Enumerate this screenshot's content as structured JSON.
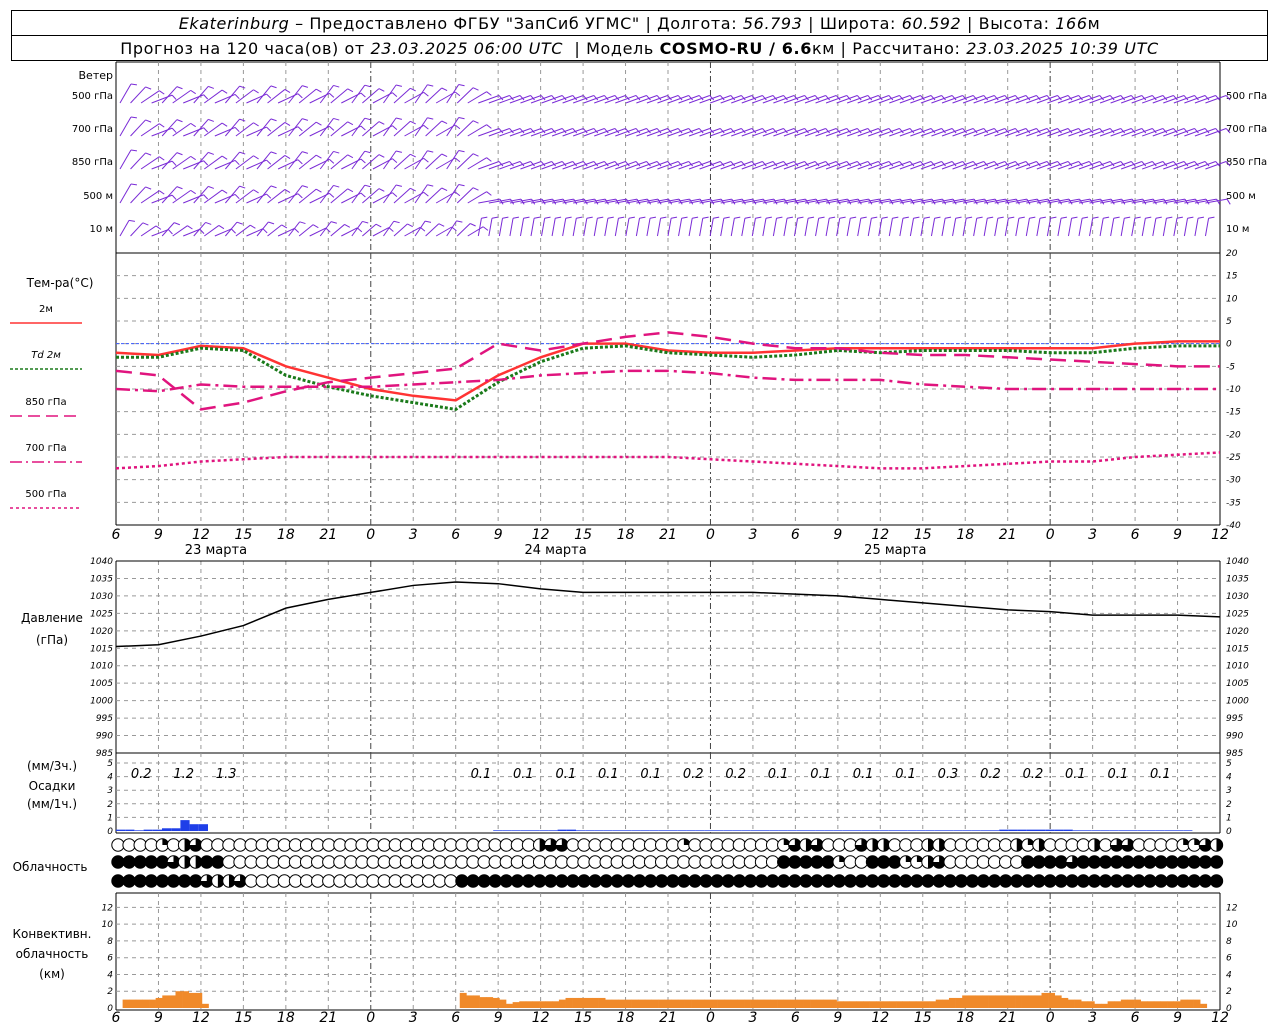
{
  "header": {
    "line1": {
      "city": "Ekaterinburg",
      "provider": " – Предоставлено ФГБУ \"ЗапСиб УГМС\" | Долгота: ",
      "lon": "56.793",
      "lat_label": " | Широта: ",
      "lat": "60.592",
      "alt_label": " | Высота: ",
      "alt": "166",
      "alt_unit": "м"
    },
    "line2": {
      "forecast": "Прогноз на 120 часа(ов) от ",
      "start": "23.03.2025 06:00 UTC",
      "model_label": "  | Модель ",
      "model": "COSMO-RU / 6.6",
      "model_unit": "км",
      "calc_label": " | Рассчитано: ",
      "calc": "23.03.2025 10:39 UTC"
    }
  },
  "colors": {
    "wind": "#7a2bd6",
    "t2m": "#ff3333",
    "td": "#1a7a1a",
    "t850": "#e0147e",
    "t700": "#e0147e",
    "t500": "#e0147e",
    "freezing": "#3b5bff",
    "pressure": "#000000",
    "precip": "#1f3fe8",
    "conv": "#f08a2a",
    "grid": "#999999"
  },
  "time_axis": {
    "hour_labels": [
      "6",
      "9",
      "12",
      "15",
      "18",
      "21",
      "0",
      "3",
      "6",
      "9",
      "12",
      "15",
      "18",
      "21",
      "0",
      "3",
      "6",
      "9",
      "12",
      "15",
      "18",
      "21",
      "0",
      "3",
      "6",
      "9",
      "12"
    ],
    "dates": [
      {
        "label": "23 марта",
        "hour_index": 2
      },
      {
        "label": "24 марта",
        "hour_index": 10
      },
      {
        "label": "25 марта",
        "hour_index": 18
      }
    ],
    "midnights": [
      6,
      14,
      22
    ]
  },
  "wind_panel": {
    "title": "Ветер",
    "levels": [
      "500 гПа",
      "700 гПа",
      "850 гПа",
      "500 м",
      "10 м"
    ]
  },
  "chart_data": [
    {
      "type": "line",
      "name": "temperature",
      "ylabel": "Тем-ра(°C)",
      "ylim": [
        -40,
        20
      ],
      "yticks": [
        20,
        15,
        10,
        5,
        0,
        -5,
        -10,
        -15,
        -20,
        -25,
        -30,
        -35,
        -40
      ],
      "legend": [
        "2м",
        "Td  2м",
        "850 гПа",
        "700 гПа",
        "500 гПа"
      ],
      "x": [
        0,
        1,
        2,
        3,
        4,
        5,
        6,
        7,
        8,
        9,
        10,
        11,
        12,
        13,
        14,
        15,
        16,
        17,
        18,
        19,
        20,
        21,
        22,
        23,
        24,
        25,
        26
      ],
      "series": [
        {
          "name": "2м",
          "values": [
            -2,
            -2.5,
            -0.5,
            -1,
            -5,
            -7.5,
            -10,
            -11.5,
            -12.5,
            -7,
            -3,
            0,
            0,
            -1.5,
            -2,
            -2,
            -1.5,
            -1,
            -1,
            -1,
            -1,
            -1,
            -1,
            -1,
            0,
            0.5,
            0.5
          ]
        },
        {
          "name": "Td  2м",
          "values": [
            -3,
            -3,
            -1,
            -1.5,
            -7,
            -9.5,
            -11.5,
            -13,
            -14.5,
            -8.5,
            -4,
            -1,
            -0.5,
            -2,
            -2.5,
            -3,
            -2.5,
            -1.5,
            -2,
            -1.5,
            -1.5,
            -1.5,
            -2,
            -2,
            -1,
            -0.5,
            -0.5
          ]
        },
        {
          "name": "850 гПа",
          "values": [
            -6,
            -7,
            -14.5,
            -13,
            -10.5,
            -8.5,
            -7.5,
            -6.5,
            -5.5,
            0,
            -1.5,
            0,
            1.5,
            2.5,
            1.5,
            0,
            -1,
            -1,
            -2,
            -2.5,
            -2.5,
            -3,
            -3.5,
            -4,
            -4.5,
            -5,
            -5
          ]
        },
        {
          "name": "700 гПа",
          "values": [
            -10,
            -10.5,
            -9,
            -9.5,
            -9.5,
            -9.5,
            -9.5,
            -9,
            -8.5,
            -8,
            -7,
            -6.5,
            -6,
            -6,
            -6.5,
            -7.5,
            -8,
            -8,
            -8,
            -9,
            -9.5,
            -10,
            -10,
            -10,
            -10,
            -10,
            -10
          ]
        },
        {
          "name": "500 гПа",
          "values": [
            -27.5,
            -27,
            -26,
            -25.5,
            -25,
            -25,
            -25,
            -25,
            -25,
            -25,
            -25,
            -25,
            -25,
            -25,
            -25.5,
            -26,
            -26.5,
            -27,
            -27.5,
            -27.5,
            -27,
            -26.5,
            -26,
            -26,
            -25,
            -24.5,
            -24
          ]
        }
      ]
    },
    {
      "type": "line",
      "name": "pressure",
      "ylabel": "Давление",
      "ylabel2": "(гПа)",
      "ylim": [
        985,
        1040
      ],
      "yticks": [
        1040,
        1035,
        1030,
        1025,
        1020,
        1015,
        1010,
        1005,
        1000,
        995,
        990,
        985
      ],
      "x": [
        0,
        1,
        2,
        3,
        4,
        5,
        6,
        7,
        8,
        9,
        10,
        11,
        12,
        13,
        14,
        15,
        16,
        17,
        18,
        19,
        20,
        21,
        22,
        23,
        24,
        25,
        26
      ],
      "series": [
        {
          "name": "pressure",
          "values": [
            1015.5,
            1016,
            1018.5,
            1021.5,
            1026.5,
            1029,
            1031,
            1033,
            1034,
            1033.5,
            1032,
            1031,
            1031,
            1031,
            1031,
            1031,
            1030.5,
            1030,
            1029,
            1028,
            1027,
            1026,
            1025.5,
            1024.5,
            1024.5,
            1024.5,
            1024
          ]
        }
      ]
    },
    {
      "type": "bar",
      "name": "precipitation",
      "ylabel": "(мм/3ч.)",
      "ylabel2": "Осадки",
      "ylabel3": "(мм/1ч.)",
      "ylim": [
        0,
        5
      ],
      "yticks": [
        5,
        4,
        3,
        2,
        1,
        0
      ],
      "values_1h": [
        0.1,
        0.1,
        0.05,
        0.1,
        0.1,
        0.2,
        0.2,
        0.8,
        0.5,
        0.5,
        0,
        0,
        0,
        0,
        0,
        0,
        0,
        0,
        0,
        0,
        0,
        0,
        0,
        0,
        0,
        0,
        0,
        0,
        0,
        0,
        0,
        0,
        0,
        0,
        0,
        0,
        0,
        0,
        0,
        0,
        0,
        0.05,
        0.05,
        0.05,
        0.05,
        0.05,
        0.05,
        0.05,
        0.1,
        0.1,
        0.05,
        0.05,
        0.05,
        0.05,
        0.05,
        0.05,
        0.05,
        0.05,
        0.05,
        0.05,
        0.05,
        0.05,
        0.05,
        0.05,
        0.05,
        0.05,
        0.05,
        0.05,
        0.05,
        0.05,
        0.05,
        0.05,
        0.05,
        0.05,
        0.05,
        0.05,
        0.05,
        0.05,
        0.05,
        0.05,
        0.05,
        0.05,
        0.05,
        0.05,
        0.05,
        0.05,
        0.05,
        0.05,
        0.05,
        0.05,
        0.05,
        0.05,
        0.05,
        0.05,
        0.05,
        0.05,
        0.1,
        0.1,
        0.1,
        0.1,
        0.1,
        0.1,
        0.1,
        0.1,
        0.05,
        0.05,
        0.05,
        0.05,
        0.05,
        0.05,
        0.05,
        0.05,
        0.05,
        0.05,
        0.05,
        0.05,
        0.05,
        0,
        0,
        0,
        0,
        0
      ],
      "labels": [
        {
          "i": 0.5,
          "text": "0.2"
        },
        {
          "i": 1.5,
          "text": "1.2"
        },
        {
          "i": 2.5,
          "text": "1.3"
        },
        {
          "i": 8.5,
          "text": "0.1"
        },
        {
          "i": 9.5,
          "text": "0.1"
        },
        {
          "i": 10.5,
          "text": "0.1"
        },
        {
          "i": 11.5,
          "text": "0.1"
        },
        {
          "i": 12.5,
          "text": "0.1"
        },
        {
          "i": 13.5,
          "text": "0.2"
        },
        {
          "i": 14.5,
          "text": "0.2"
        },
        {
          "i": 15.5,
          "text": "0.1"
        },
        {
          "i": 16.5,
          "text": "0.1"
        },
        {
          "i": 17.5,
          "text": "0.1"
        },
        {
          "i": 18.5,
          "text": "0.1"
        },
        {
          "i": 19.5,
          "text": "0.3"
        },
        {
          "i": 20.5,
          "text": "0.2"
        },
        {
          "i": 21.5,
          "text": "0.2"
        },
        {
          "i": 22.5,
          "text": "0.1"
        },
        {
          "i": 23.5,
          "text": "0.1"
        },
        {
          "i": 24.5,
          "text": "0.1"
        }
      ]
    },
    {
      "type": "bar",
      "name": "convective_cloud",
      "ylabel": "Конвективн.",
      "ylabel2": "облачность",
      "ylabel3": "(км)",
      "ylim": [
        0,
        13
      ],
      "yticks": [
        12,
        10,
        8,
        6,
        4,
        2,
        0
      ],
      "values": [
        0,
        1,
        1,
        1,
        1,
        1,
        1.2,
        1.5,
        1.5,
        2,
        2,
        1.8,
        1.8,
        0.5,
        0,
        0,
        0,
        0,
        0,
        0,
        0,
        0,
        0,
        0,
        0,
        0,
        0,
        0,
        0,
        0,
        0,
        0,
        0,
        0,
        0,
        0,
        0,
        0,
        0,
        0,
        0,
        0,
        0,
        0,
        0,
        0,
        0,
        0,
        0,
        0,
        0,
        0,
        1.8,
        1.5,
        1.5,
        1.3,
        1.3,
        1.2,
        1,
        0.5,
        0.7,
        0.8,
        0.8,
        0.8,
        0.8,
        0.8,
        0.8,
        1,
        1.2,
        1.2,
        1.2,
        1.2,
        1.2,
        1.2,
        1,
        1,
        1,
        1,
        1,
        1,
        1,
        1,
        1,
        1,
        1,
        1,
        1,
        1,
        1,
        1,
        1,
        1,
        1,
        1,
        1,
        1,
        1,
        1,
        1,
        1,
        1,
        1,
        1,
        1,
        1,
        1,
        1,
        1,
        1,
        0.8,
        0.8,
        0.8,
        0.8,
        0.8,
        0.8,
        0.8,
        0.8,
        0.8,
        0.8,
        0.8,
        0.8,
        0.8,
        0.8,
        0.8,
        1,
        1,
        1.2,
        1.2,
        1.5,
        1.5,
        1.5,
        1.5,
        1.5,
        1.5,
        1.5,
        1.5,
        1.5,
        1.5,
        1.5,
        1.5,
        1.8,
        1.8,
        1.5,
        1.2,
        1,
        1,
        0.8,
        0.8,
        0.5,
        0.5,
        0.8,
        0.8,
        1,
        1,
        1,
        0.8,
        0.8,
        0.8,
        0.8,
        0.8,
        0.8,
        1,
        1,
        1,
        0.5,
        0,
        0
      ]
    }
  ],
  "cloud_panel": {
    "title": "Облачность",
    "rows": [
      "0000102300000000000000000000000000000023300000000001000000001323000322000220000002120000203300001132",
      "4444432244000000000000000000000000000000000000000000000000004444410044411230000000444434444444444444",
      "4444444432230000000000000000000444444444444444444444444444444444444444444444444444444444444444444444"
    ]
  }
}
